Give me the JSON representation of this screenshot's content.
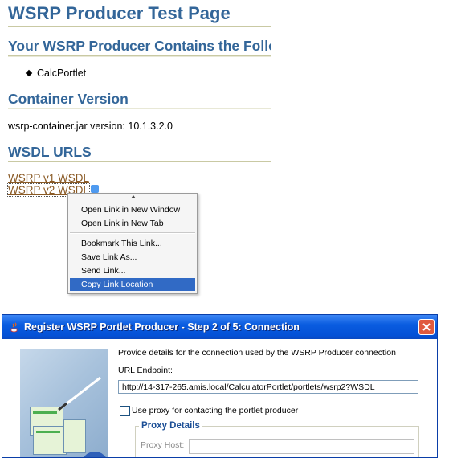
{
  "page": {
    "title": "WSRP Producer Test Page",
    "contains_heading": "Your WSRP Producer Contains the Follo",
    "portlets": [
      "CalcPortlet"
    ],
    "container_heading": "Container Version",
    "container_version": "wsrp-container.jar version: 10.1.3.2.0",
    "wsdl_heading": "WSDL URLS",
    "links": [
      "WSRP v1 WSDL",
      "WSRP v2 WSDL"
    ]
  },
  "context_menu": {
    "groups": [
      [
        "Open Link in New Window",
        "Open Link in New Tab"
      ],
      [
        "Bookmark This Link...",
        "Save Link As...",
        "Send Link...",
        "Copy Link Location"
      ]
    ],
    "selected": "Copy Link Location"
  },
  "dialog": {
    "title": "Register WSRP Portlet Producer - Step 2 of 5: Connection",
    "description": "Provide details for the connection used by the WSRP Producer connection",
    "url_label": "URL Endpoint:",
    "url_value": "http://14-317-265.amis.local/CalculatorPortlet/portlets/wsrp2?WSDL",
    "use_proxy_label": "Use proxy for contacting the portlet producer",
    "use_proxy_checked": false,
    "proxy_group_title": "Proxy Details",
    "proxy_host_label": "Proxy Host:",
    "proxy_host_value": ""
  },
  "colors": {
    "heading": "#336699",
    "link": "#8a5a25",
    "menu_selection": "#316ac5",
    "titlebar": "#0451d6"
  }
}
